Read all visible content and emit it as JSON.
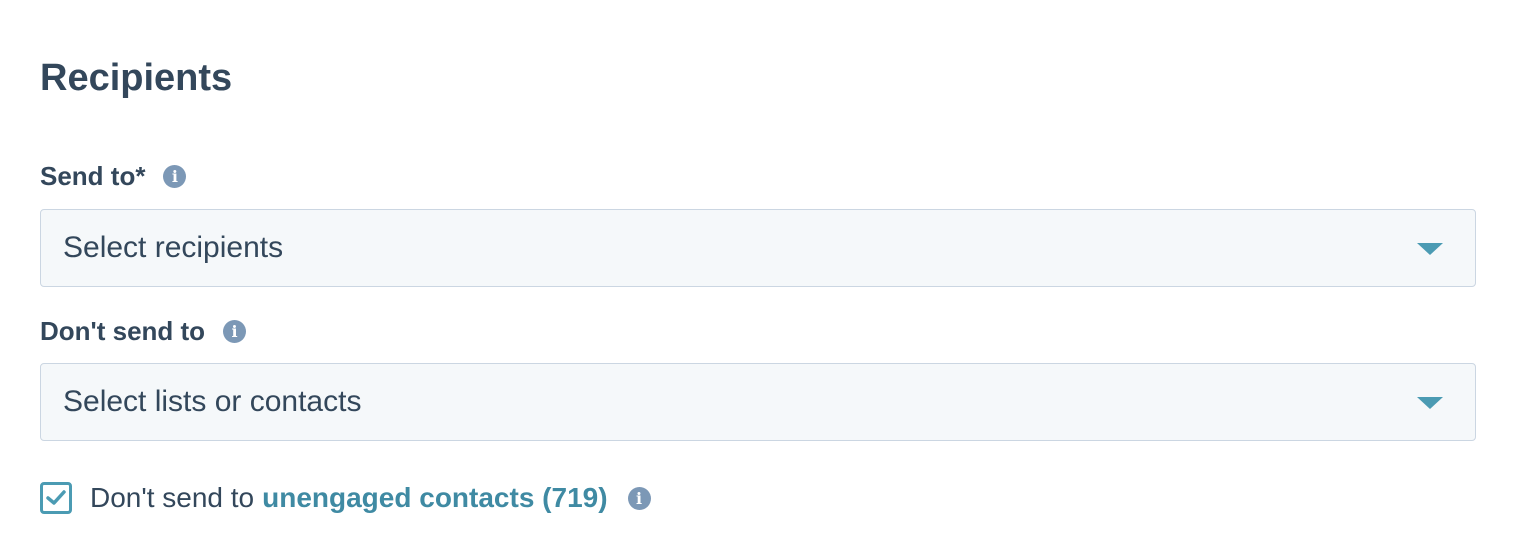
{
  "section": {
    "title": "Recipients"
  },
  "send_to": {
    "label": "Send to*",
    "info_icon": "info-icon",
    "placeholder": "Select recipients"
  },
  "dont_send_to": {
    "label": "Don't send to",
    "info_icon": "info-icon",
    "placeholder": "Select lists or contacts"
  },
  "unengaged": {
    "checked": true,
    "text": "Don't send to",
    "link_text": "unengaged contacts (719)",
    "info_icon": "info-icon"
  },
  "colors": {
    "text": "#33475b",
    "accent": "#4b9bb3",
    "info_icon": "#7c98b6",
    "field_background": "#f5f8fa",
    "field_border": "#cbd6e2"
  }
}
